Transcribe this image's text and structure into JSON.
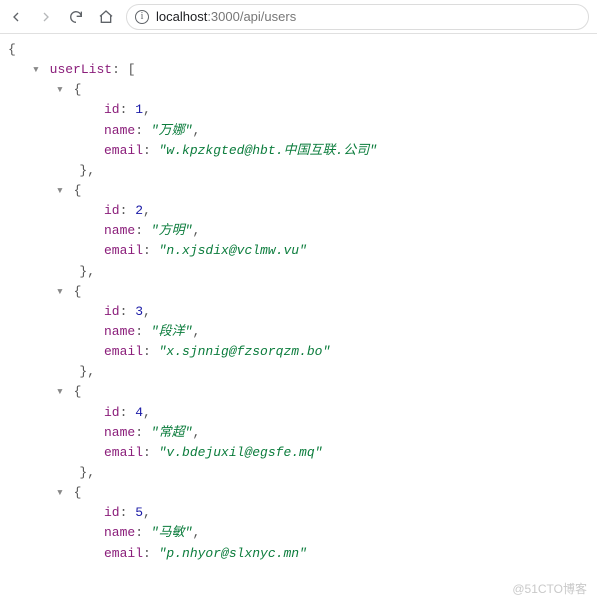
{
  "toolbar": {
    "url_host": "localhost",
    "url_port_path": ":3000/api/users"
  },
  "json": {
    "root_key": "userList",
    "items": [
      {
        "id": 1,
        "name": "万娜",
        "email": "w.kpzkgted@hbt.中国互联.公司"
      },
      {
        "id": 2,
        "name": "方明",
        "email": "n.xjsdix@vclmw.vu"
      },
      {
        "id": 3,
        "name": "段洋",
        "email": "x.sjnnig@fzsorqzm.bo"
      },
      {
        "id": 4,
        "name": "常超",
        "email": "v.bdejuxil@egsfe.mq"
      },
      {
        "id": 5,
        "name": "马敏",
        "email": "p.nhyor@slxnyc.mn"
      }
    ],
    "field_labels": {
      "id": "id",
      "name": "name",
      "email": "email"
    }
  },
  "watermark": "@51CTO博客"
}
